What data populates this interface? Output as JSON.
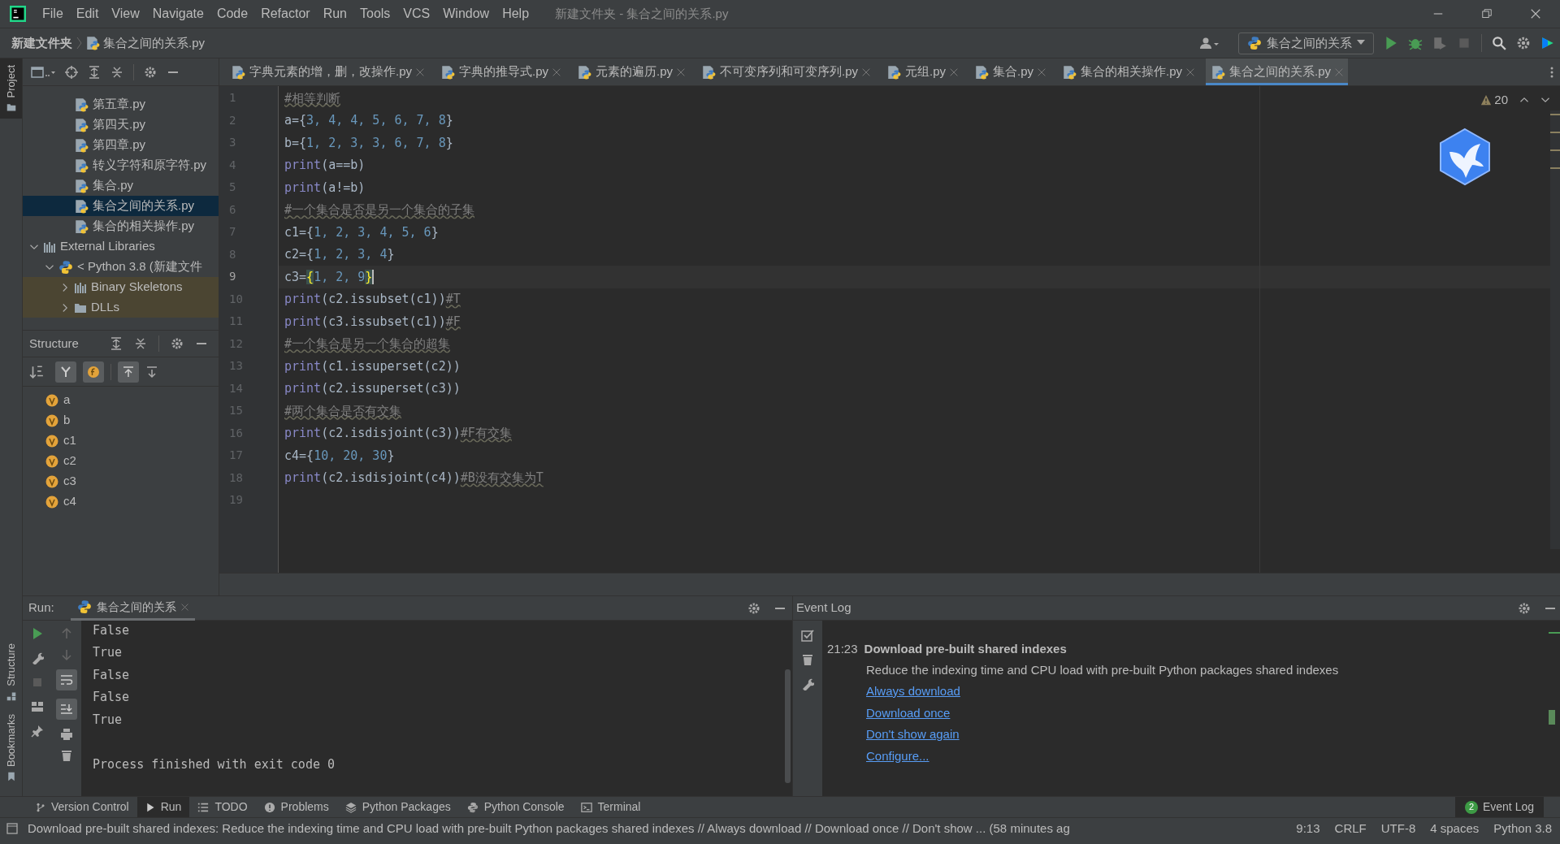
{
  "window": {
    "title": "新建文件夹 - 集合之间的关系.py"
  },
  "menu": [
    "File",
    "Edit",
    "View",
    "Navigate",
    "Code",
    "Refactor",
    "Run",
    "Tools",
    "VCS",
    "Window",
    "Help"
  ],
  "breadcrumb": [
    "新建文件夹",
    "集合之间的关系.py"
  ],
  "run_config": {
    "label": "集合之间的关系"
  },
  "side_tabs_top": [
    {
      "label": "Project",
      "selected": true
    }
  ],
  "side_tabs_bottom": [
    {
      "label": "Structure",
      "selected": false
    },
    {
      "label": "Bookmarks",
      "selected": false
    }
  ],
  "project_tree": [
    {
      "label": "第五章.py",
      "kind": "file",
      "selected": false
    },
    {
      "label": "第四天.py",
      "kind": "file",
      "selected": false
    },
    {
      "label": "第四章.py",
      "kind": "file",
      "selected": false
    },
    {
      "label": "转义字符和原字符.py",
      "kind": "file",
      "selected": false
    },
    {
      "label": "集合.py",
      "kind": "file",
      "selected": false
    },
    {
      "label": "集合之间的关系.py",
      "kind": "file",
      "selected": true
    },
    {
      "label": "集合的相关操作.py",
      "kind": "file",
      "selected": false
    },
    {
      "label": "External Libraries",
      "kind": "libraries",
      "selected": false,
      "expanded": true,
      "children": [
        {
          "label": "< Python 3.8 (新建文件",
          "kind": "sdk",
          "selected": false,
          "expanded": true,
          "children": [
            {
              "label": "Binary Skeletons",
              "kind": "library",
              "selected": false,
              "expanded": false
            },
            {
              "label": "DLLs",
              "kind": "folder",
              "selected": false,
              "expanded": false
            }
          ]
        }
      ]
    }
  ],
  "structure": {
    "title": "Structure",
    "items": [
      "a",
      "b",
      "c1",
      "c2",
      "c3",
      "c4"
    ]
  },
  "tabs": [
    {
      "label": "字典元素的增，删，改操作.py",
      "selected": false
    },
    {
      "label": "字典的推导式.py",
      "selected": false
    },
    {
      "label": "元素的遍历.py",
      "selected": false
    },
    {
      "label": "不可变序列和可变序列.py",
      "selected": false
    },
    {
      "label": "元组.py",
      "selected": false
    },
    {
      "label": "集合.py",
      "selected": false
    },
    {
      "label": "集合的相关操作.py",
      "selected": false
    },
    {
      "label": "集合之间的关系.py",
      "selected": true
    }
  ],
  "inspections": {
    "warnings": "20"
  },
  "code": [
    {
      "number": "1",
      "current": false,
      "segments": [
        {
          "text": "#相等判断",
          "kind": "comment"
        }
      ]
    },
    {
      "number": "2",
      "current": false,
      "segments": [
        {
          "text": "a={",
          "kind": "plain"
        },
        {
          "text": "3, 4, 4, 5, 6, 7, 8",
          "kind": "number"
        },
        {
          "text": "}",
          "kind": "plain"
        }
      ]
    },
    {
      "number": "3",
      "current": false,
      "segments": [
        {
          "text": "b={",
          "kind": "plain"
        },
        {
          "text": "1, 2, 3, 3, 6, 7, 8",
          "kind": "number"
        },
        {
          "text": "}",
          "kind": "plain"
        }
      ]
    },
    {
      "number": "4",
      "current": false,
      "segments": [
        {
          "text": "print",
          "kind": "builtin"
        },
        {
          "text": "(a==b)",
          "kind": "plain"
        }
      ]
    },
    {
      "number": "5",
      "current": false,
      "segments": [
        {
          "text": "print",
          "kind": "builtin"
        },
        {
          "text": "(a!=b)",
          "kind": "plain"
        }
      ]
    },
    {
      "number": "6",
      "current": false,
      "segments": [
        {
          "text": "#一个集合是否是另一个集合的子集",
          "kind": "comment"
        }
      ]
    },
    {
      "number": "7",
      "current": false,
      "segments": [
        {
          "text": "c1={",
          "kind": "plain"
        },
        {
          "text": "1, 2, 3, 4, 5, 6",
          "kind": "number"
        },
        {
          "text": "}",
          "kind": "plain"
        }
      ]
    },
    {
      "number": "8",
      "current": false,
      "segments": [
        {
          "text": "c2={",
          "kind": "plain"
        },
        {
          "text": "1, 2, 3, 4",
          "kind": "number"
        },
        {
          "text": "}",
          "kind": "plain"
        }
      ]
    },
    {
      "number": "9",
      "current": true,
      "segments": [
        {
          "text": "c3=",
          "kind": "plain"
        },
        {
          "text": "{",
          "kind": "brace"
        },
        {
          "text": "1, 2, 9",
          "kind": "number"
        },
        {
          "text": "}",
          "kind": "brace"
        }
      ]
    },
    {
      "number": "10",
      "current": false,
      "segments": [
        {
          "text": "print",
          "kind": "builtin"
        },
        {
          "text": "(c2.issubset(c1))",
          "kind": "plain"
        },
        {
          "text": "#T",
          "kind": "comment"
        }
      ]
    },
    {
      "number": "11",
      "current": false,
      "segments": [
        {
          "text": "print",
          "kind": "builtin"
        },
        {
          "text": "(c3.issubset(c1))",
          "kind": "plain"
        },
        {
          "text": "#F",
          "kind": "comment"
        }
      ]
    },
    {
      "number": "12",
      "current": false,
      "segments": [
        {
          "text": "#一个集合是另一个集合的超集",
          "kind": "comment"
        }
      ]
    },
    {
      "number": "13",
      "current": false,
      "segments": [
        {
          "text": "print",
          "kind": "builtin"
        },
        {
          "text": "(c1.issuperset(c2))",
          "kind": "plain"
        }
      ]
    },
    {
      "number": "14",
      "current": false,
      "segments": [
        {
          "text": "print",
          "kind": "builtin"
        },
        {
          "text": "(c2.issuperset(c3))",
          "kind": "plain"
        }
      ]
    },
    {
      "number": "15",
      "current": false,
      "segments": [
        {
          "text": "#两个集合是否有交集",
          "kind": "comment"
        }
      ]
    },
    {
      "number": "16",
      "current": false,
      "segments": [
        {
          "text": "print",
          "kind": "builtin"
        },
        {
          "text": "(c2.isdisjoint(c3))",
          "kind": "plain"
        },
        {
          "text": "#F有交集",
          "kind": "comment"
        }
      ]
    },
    {
      "number": "17",
      "current": false,
      "segments": [
        {
          "text": "c4={",
          "kind": "plain"
        },
        {
          "text": "10, 20, 30",
          "kind": "number"
        },
        {
          "text": "}",
          "kind": "plain"
        }
      ]
    },
    {
      "number": "18",
      "current": false,
      "segments": [
        {
          "text": "print",
          "kind": "builtin"
        },
        {
          "text": "(c2.isdisjoint(c4))",
          "kind": "plain"
        },
        {
          "text": "#B没有交集为T",
          "kind": "comment"
        }
      ]
    },
    {
      "number": "19",
      "current": false
    }
  ],
  "run_panel": {
    "label": "Run:",
    "tab": "集合之间的关系",
    "output": [
      {
        "text": "False",
        "gap_before": false
      },
      {
        "text": "True",
        "gap_before": false
      },
      {
        "text": "False",
        "gap_before": false
      },
      {
        "text": "False",
        "gap_before": false
      },
      {
        "text": "True",
        "gap_before": false
      },
      {
        "text": "Process finished with exit code 0",
        "gap_before": true
      }
    ]
  },
  "event_log": {
    "title": "Event Log",
    "time": "21:23",
    "heading": "Download pre-built shared indexes",
    "message": "Reduce the indexing time and CPU load with pre-built Python packages shared indexes",
    "links": [
      "Always download",
      "Download once",
      "Don't show again",
      "Configure..."
    ]
  },
  "tool_tabs": [
    {
      "label": "Version Control",
      "selected": false
    },
    {
      "label": "Run",
      "selected": true
    },
    {
      "label": "TODO",
      "selected": false
    },
    {
      "label": "Problems",
      "selected": false
    },
    {
      "label": "Python Packages",
      "selected": false
    },
    {
      "label": "Python Console",
      "selected": false
    },
    {
      "label": "Terminal",
      "selected": false
    }
  ],
  "event_log_tab": {
    "label": "Event Log",
    "badge": "2"
  },
  "status_bar": {
    "message": "Download pre-built shared indexes: Reduce the indexing time and CPU load with pre-built Python packages shared indexes // Always download // Download once // Don't show ... (58 minutes ag",
    "items": [
      "9:13",
      "CRLF",
      "UTF-8",
      "4 spaces",
      "Python 3.8"
    ]
  }
}
